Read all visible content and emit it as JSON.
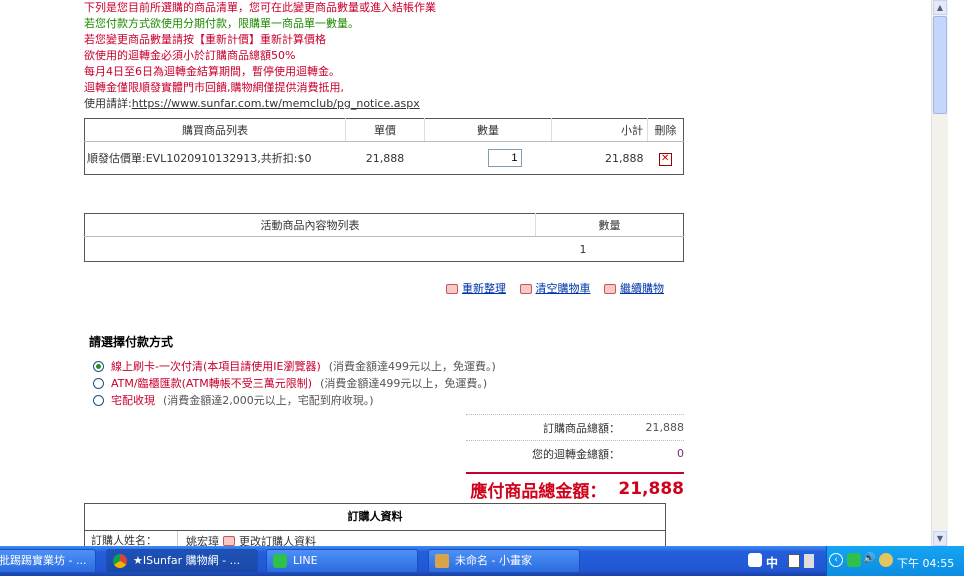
{
  "notices": [
    {
      "text": "下列是您目前所選購的商品清單，您可在此變更商品數量或進入結帳作業",
      "color": "red"
    },
    {
      "text": "若您付款方式欲使用分期付款，限購單一商品單一數量。",
      "color": "green"
    },
    {
      "text": "若您變更商品數量請按【重新計價】重新計算價格",
      "color": "red"
    },
    {
      "text": "欲使用的迴轉金必須小於訂購商品總額50%",
      "color": "red"
    },
    {
      "text": "每月4日至6日為迴轉金結算期間，暫停使用迴轉金。",
      "color": "red"
    },
    {
      "text": "迴轉金僅限順發實體門市回饋,購物網僅提供消費抵用,",
      "color": "red"
    }
  ],
  "notice_link_prefix": "使用請詳:",
  "notice_link": "https://www.sunfar.com.tw/memclub/pg_notice.aspx",
  "cart": {
    "headers": {
      "product": "購買商品列表",
      "price": "單價",
      "qty": "數量",
      "subtotal": "小計",
      "delete": "刪除"
    },
    "items": [
      {
        "name": "順發估價單:EVL1020910132913,共折扣:$0",
        "price": "21,888",
        "qty": "1",
        "subtotal": "21,888"
      }
    ]
  },
  "promo": {
    "headers": {
      "content": "活動商品內容物列表",
      "qty": "數量"
    },
    "rows": [
      {
        "content": "",
        "qty": "1"
      }
    ]
  },
  "actions": {
    "recalc": "重新整理",
    "clear": "清空購物車",
    "continue": "繼續購物"
  },
  "payment": {
    "title": "請選擇付款方式",
    "options": [
      {
        "label": "線上刷卡-一次付清(本項目請使用IE瀏覽器)",
        "note": "(消費金額達499元以上，免運費。)",
        "selected": true
      },
      {
        "label": "ATM/臨櫃匯款(ATM轉帳不受三萬元限制)",
        "note": "(消費金額達499元以上，免運費。)",
        "selected": false
      },
      {
        "label": "宅配收現",
        "note": "(消費金額達2,000元以上，宅配到府收現。)",
        "selected": false
      }
    ]
  },
  "summary": {
    "order_total_label": "訂購商品總額：",
    "order_total_value": "21,888",
    "rebate_label": "您的迴轉金總額：",
    "rebate_value": "0",
    "payable_label": "應付商品總金額：",
    "payable_value": "21,888"
  },
  "buyer": {
    "title": "訂購人資料",
    "name_label": "訂購人姓名：",
    "name_value": "姚宏璋",
    "edit_label": "更改訂購人資料"
  },
  "taskbar": {
    "items": [
      {
        "label": "批踢踢實業坊 - ...",
        "icon_color": "#e6e6e6"
      },
      {
        "label": "★ISunfar 購物網 - ...",
        "icon_color": "#e9a020"
      },
      {
        "label": "LINE",
        "icon_color": "#2ec04a"
      },
      {
        "label": "未命名 - 小畫家",
        "icon_color": "#d9a34a"
      }
    ],
    "ime": "中",
    "clock": "下午 04:55"
  },
  "colors": {
    "accent_red": "#c8002d",
    "total_red": "#d0021b",
    "taskbar_blue": "#245edb"
  }
}
